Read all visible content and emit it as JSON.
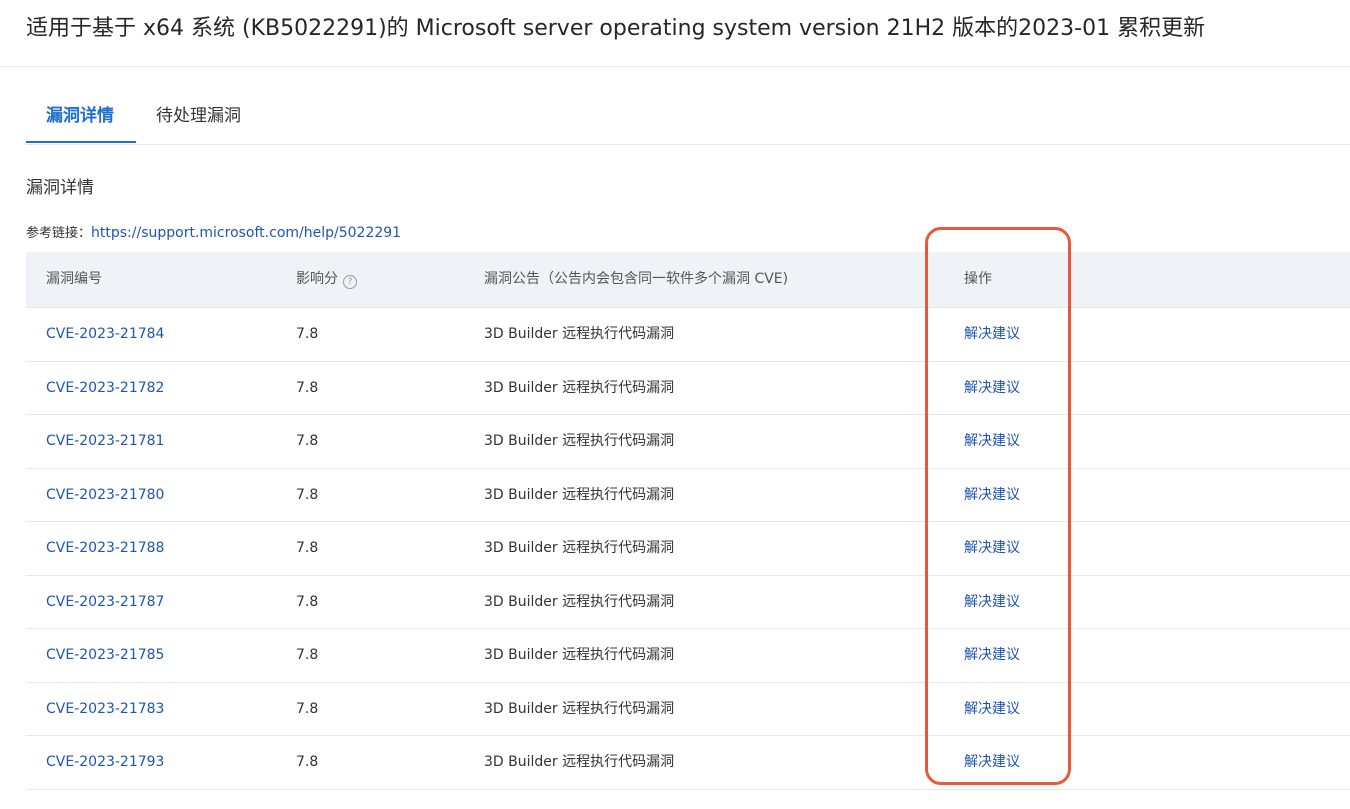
{
  "page_title": "适用于基于 x64 系统 (KB5022291)的 Microsoft server operating system version 21H2 版本的2023-01 累积更新",
  "tabs": [
    {
      "label": "漏洞详情",
      "active": true
    },
    {
      "label": "待处理漏洞",
      "active": false
    }
  ],
  "section_title": "漏洞详情",
  "reference": {
    "label": "参考链接：",
    "url": "https://support.microsoft.com/help/5022291"
  },
  "table": {
    "headers": {
      "id": "漏洞编号",
      "score": "影响分",
      "score_help_icon": "question-circle-icon",
      "desc": "漏洞公告（公告内会包含同一软件多个漏洞 CVE)",
      "op": "操作"
    },
    "rows": [
      {
        "id": "CVE-2023-21784",
        "score": "7.8",
        "desc": "3D Builder 远程执行代码漏洞",
        "op": "解决建议"
      },
      {
        "id": "CVE-2023-21782",
        "score": "7.8",
        "desc": "3D Builder 远程执行代码漏洞",
        "op": "解决建议"
      },
      {
        "id": "CVE-2023-21781",
        "score": "7.8",
        "desc": "3D Builder 远程执行代码漏洞",
        "op": "解决建议"
      },
      {
        "id": "CVE-2023-21780",
        "score": "7.8",
        "desc": "3D Builder 远程执行代码漏洞",
        "op": "解决建议"
      },
      {
        "id": "CVE-2023-21788",
        "score": "7.8",
        "desc": "3D Builder 远程执行代码漏洞",
        "op": "解决建议"
      },
      {
        "id": "CVE-2023-21787",
        "score": "7.8",
        "desc": "3D Builder 远程执行代码漏洞",
        "op": "解决建议"
      },
      {
        "id": "CVE-2023-21785",
        "score": "7.8",
        "desc": "3D Builder 远程执行代码漏洞",
        "op": "解决建议"
      },
      {
        "id": "CVE-2023-21783",
        "score": "7.8",
        "desc": "3D Builder 远程执行代码漏洞",
        "op": "解决建议"
      },
      {
        "id": "CVE-2023-21793",
        "score": "7.8",
        "desc": "3D Builder 远程执行代码漏洞",
        "op": "解决建议"
      }
    ]
  },
  "colors": {
    "accent": "#1e6fd0",
    "link": "#1e55b3",
    "header_bg": "#eff2f6",
    "highlight": "#e8583a"
  }
}
